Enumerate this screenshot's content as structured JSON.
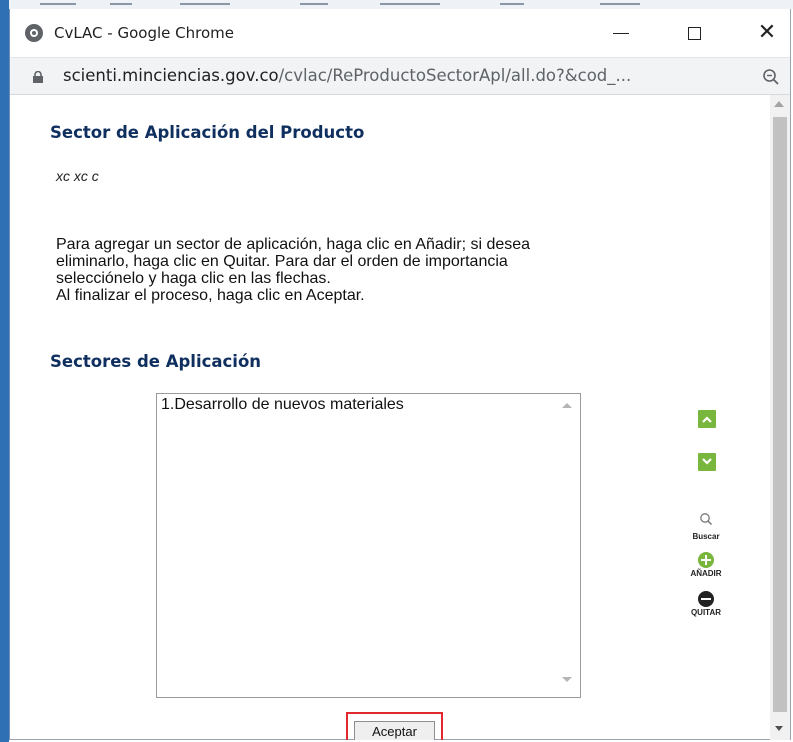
{
  "window": {
    "title": "CvLAC - Google Chrome"
  },
  "addressbar": {
    "host": "scienti.minciencias.gov.co",
    "path": "/cvlac/ReProductoSectorApl/all.do?&cod_..."
  },
  "page": {
    "heading": "Sector de Aplicación del Producto",
    "product_name": "xc xc c",
    "instructions": [
      "Para agregar un sector de aplicación, haga clic en Añadir; si desea",
      "eliminarlo, haga clic en Quitar. Para dar el orden de importancia",
      "selecciónelo y haga clic en las flechas.",
      "Al finalizar el proceso, haga clic en Aceptar."
    ],
    "sectores_heading": "Sectores de Aplicación",
    "list_items": [
      "1.Desarrollo de nuevos materiales"
    ],
    "tools": {
      "buscar": "Buscar",
      "anadir": "AÑADIR",
      "quitar": "QUITAR"
    },
    "accept_button": "Aceptar"
  },
  "colors": {
    "heading": "#0f2f5f",
    "green_icon": "#78b63e",
    "highlight_border": "#e0282e"
  },
  "icons": {
    "favicon": "chrome-logo-icon",
    "lock": "lock-icon",
    "zoom": "zoom-icon",
    "move_up": "chevron-up-icon",
    "move_down": "chevron-down-icon",
    "search": "search-icon",
    "add": "plus-circle-icon",
    "remove": "minus-circle-icon"
  }
}
